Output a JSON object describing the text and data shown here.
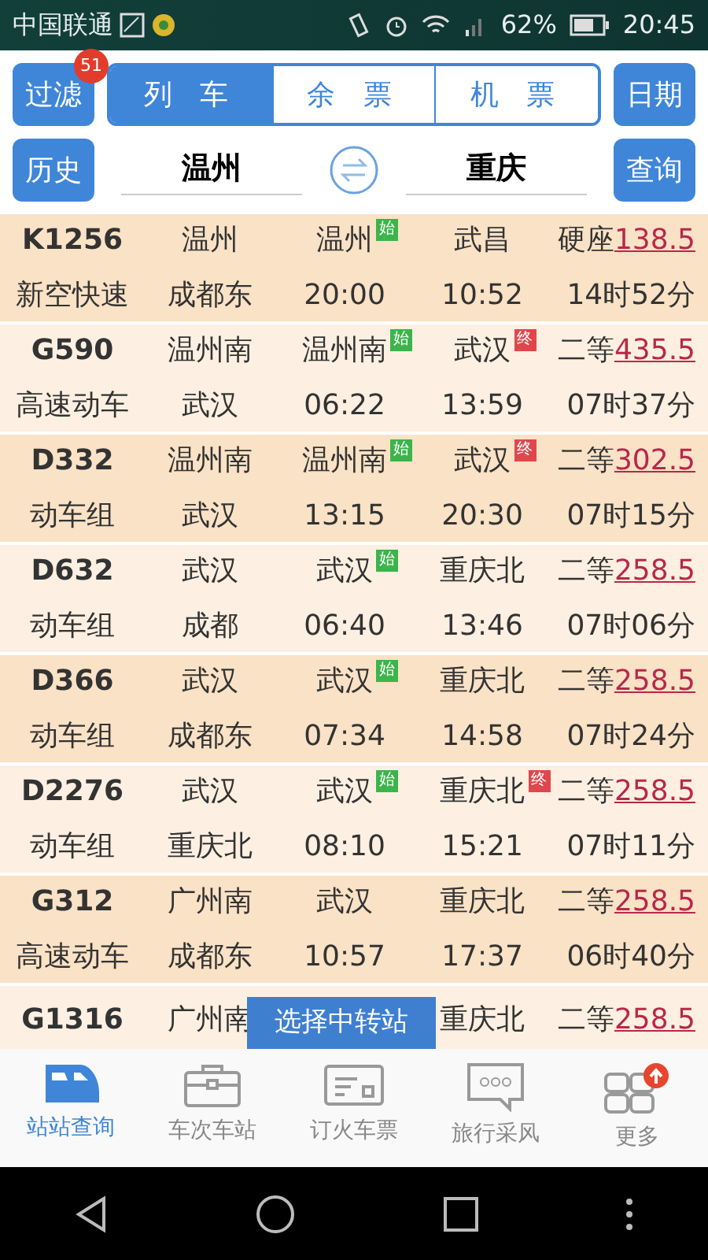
{
  "status_bar": {
    "carrier": "中国联通",
    "battery": "62%",
    "time": "20:45"
  },
  "toolbar": {
    "filter_button": "过滤",
    "filter_count": "51",
    "tabs": [
      {
        "label": "列 车",
        "selected": true
      },
      {
        "label": "余 票",
        "selected": false
      },
      {
        "label": "机 票",
        "selected": false
      }
    ],
    "date_button": "日期"
  },
  "route": {
    "history_button": "历史",
    "from": "温州",
    "to": "重庆",
    "query_button": "查询"
  },
  "trains": [
    {
      "number": "K1256",
      "type": "新空快速",
      "from": "温州",
      "to": "成都东",
      "depart_station": "温州",
      "depart_tag": "始",
      "depart_time": "20:00",
      "arrive_station": "武昌",
      "arrive_time": "10:52",
      "seat": "硬座",
      "price": "138.5",
      "duration": "14时52分"
    },
    {
      "number": "G590",
      "type": "高速动车",
      "from": "温州南",
      "to": "武汉",
      "depart_station": "温州南",
      "depart_tag": "始",
      "depart_time": "06:22",
      "arrive_station": "武汉",
      "arrive_tag": "终",
      "arrive_time": "13:59",
      "seat": "二等",
      "price": "435.5",
      "duration": "07时37分"
    },
    {
      "number": "D332",
      "type": "动车组",
      "from": "温州南",
      "to": "武汉",
      "depart_station": "温州南",
      "depart_tag": "始",
      "depart_time": "13:15",
      "arrive_station": "武汉",
      "arrive_tag": "终",
      "arrive_time": "20:30",
      "seat": "二等",
      "price": "302.5",
      "duration": "07时15分"
    },
    {
      "number": "D632",
      "type": "动车组",
      "from": "武汉",
      "to": "成都",
      "depart_station": "武汉",
      "depart_tag": "始",
      "depart_time": "06:40",
      "arrive_station": "重庆北",
      "arrive_time": "13:46",
      "seat": "二等",
      "price": "258.5",
      "duration": "07时06分"
    },
    {
      "number": "D366",
      "type": "动车组",
      "from": "武汉",
      "to": "成都东",
      "depart_station": "武汉",
      "depart_tag": "始",
      "depart_time": "07:34",
      "arrive_station": "重庆北",
      "arrive_time": "14:58",
      "seat": "二等",
      "price": "258.5",
      "duration": "07时24分"
    },
    {
      "number": "D2276",
      "type": "动车组",
      "from": "武汉",
      "to": "重庆北",
      "depart_station": "武汉",
      "depart_tag": "始",
      "depart_time": "08:10",
      "arrive_station": "重庆北",
      "arrive_tag": "终",
      "arrive_time": "15:21",
      "seat": "二等",
      "price": "258.5",
      "duration": "07时11分"
    },
    {
      "number": "G312",
      "type": "高速动车",
      "from": "广州南",
      "to": "成都东",
      "depart_station": "武汉",
      "depart_time": "10:57",
      "arrive_station": "重庆北",
      "arrive_time": "17:37",
      "seat": "二等",
      "price": "258.5",
      "duration": "06时40分"
    },
    {
      "number": "G1316",
      "from": "广州南",
      "arrive_station": "重庆北",
      "seat": "二等",
      "price": "258.5"
    }
  ],
  "toast": "选择中转站",
  "bottom_nav": [
    {
      "label": "站站查询",
      "kind": "train",
      "selected": true
    },
    {
      "label": "车次车站",
      "kind": "case",
      "selected": false
    },
    {
      "label": "订火车票",
      "kind": "ticket",
      "selected": false
    },
    {
      "label": "旅行采风",
      "kind": "chat",
      "selected": false
    },
    {
      "label": "更多",
      "kind": "grid",
      "selected": false
    }
  ]
}
